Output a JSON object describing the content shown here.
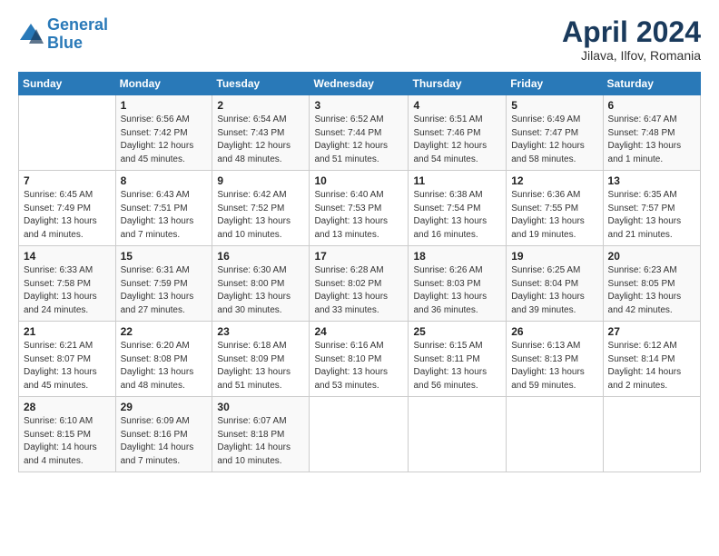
{
  "header": {
    "logo_line1": "General",
    "logo_line2": "Blue",
    "title": "April 2024",
    "subtitle": "Jilava, Ilfov, Romania"
  },
  "weekdays": [
    "Sunday",
    "Monday",
    "Tuesday",
    "Wednesday",
    "Thursday",
    "Friday",
    "Saturday"
  ],
  "weeks": [
    [
      {
        "day": "",
        "info": ""
      },
      {
        "day": "1",
        "info": "Sunrise: 6:56 AM\nSunset: 7:42 PM\nDaylight: 12 hours\nand 45 minutes."
      },
      {
        "day": "2",
        "info": "Sunrise: 6:54 AM\nSunset: 7:43 PM\nDaylight: 12 hours\nand 48 minutes."
      },
      {
        "day": "3",
        "info": "Sunrise: 6:52 AM\nSunset: 7:44 PM\nDaylight: 12 hours\nand 51 minutes."
      },
      {
        "day": "4",
        "info": "Sunrise: 6:51 AM\nSunset: 7:46 PM\nDaylight: 12 hours\nand 54 minutes."
      },
      {
        "day": "5",
        "info": "Sunrise: 6:49 AM\nSunset: 7:47 PM\nDaylight: 12 hours\nand 58 minutes."
      },
      {
        "day": "6",
        "info": "Sunrise: 6:47 AM\nSunset: 7:48 PM\nDaylight: 13 hours\nand 1 minute."
      }
    ],
    [
      {
        "day": "7",
        "info": "Sunrise: 6:45 AM\nSunset: 7:49 PM\nDaylight: 13 hours\nand 4 minutes."
      },
      {
        "day": "8",
        "info": "Sunrise: 6:43 AM\nSunset: 7:51 PM\nDaylight: 13 hours\nand 7 minutes."
      },
      {
        "day": "9",
        "info": "Sunrise: 6:42 AM\nSunset: 7:52 PM\nDaylight: 13 hours\nand 10 minutes."
      },
      {
        "day": "10",
        "info": "Sunrise: 6:40 AM\nSunset: 7:53 PM\nDaylight: 13 hours\nand 13 minutes."
      },
      {
        "day": "11",
        "info": "Sunrise: 6:38 AM\nSunset: 7:54 PM\nDaylight: 13 hours\nand 16 minutes."
      },
      {
        "day": "12",
        "info": "Sunrise: 6:36 AM\nSunset: 7:55 PM\nDaylight: 13 hours\nand 19 minutes."
      },
      {
        "day": "13",
        "info": "Sunrise: 6:35 AM\nSunset: 7:57 PM\nDaylight: 13 hours\nand 21 minutes."
      }
    ],
    [
      {
        "day": "14",
        "info": "Sunrise: 6:33 AM\nSunset: 7:58 PM\nDaylight: 13 hours\nand 24 minutes."
      },
      {
        "day": "15",
        "info": "Sunrise: 6:31 AM\nSunset: 7:59 PM\nDaylight: 13 hours\nand 27 minutes."
      },
      {
        "day": "16",
        "info": "Sunrise: 6:30 AM\nSunset: 8:00 PM\nDaylight: 13 hours\nand 30 minutes."
      },
      {
        "day": "17",
        "info": "Sunrise: 6:28 AM\nSunset: 8:02 PM\nDaylight: 13 hours\nand 33 minutes."
      },
      {
        "day": "18",
        "info": "Sunrise: 6:26 AM\nSunset: 8:03 PM\nDaylight: 13 hours\nand 36 minutes."
      },
      {
        "day": "19",
        "info": "Sunrise: 6:25 AM\nSunset: 8:04 PM\nDaylight: 13 hours\nand 39 minutes."
      },
      {
        "day": "20",
        "info": "Sunrise: 6:23 AM\nSunset: 8:05 PM\nDaylight: 13 hours\nand 42 minutes."
      }
    ],
    [
      {
        "day": "21",
        "info": "Sunrise: 6:21 AM\nSunset: 8:07 PM\nDaylight: 13 hours\nand 45 minutes."
      },
      {
        "day": "22",
        "info": "Sunrise: 6:20 AM\nSunset: 8:08 PM\nDaylight: 13 hours\nand 48 minutes."
      },
      {
        "day": "23",
        "info": "Sunrise: 6:18 AM\nSunset: 8:09 PM\nDaylight: 13 hours\nand 51 minutes."
      },
      {
        "day": "24",
        "info": "Sunrise: 6:16 AM\nSunset: 8:10 PM\nDaylight: 13 hours\nand 53 minutes."
      },
      {
        "day": "25",
        "info": "Sunrise: 6:15 AM\nSunset: 8:11 PM\nDaylight: 13 hours\nand 56 minutes."
      },
      {
        "day": "26",
        "info": "Sunrise: 6:13 AM\nSunset: 8:13 PM\nDaylight: 13 hours\nand 59 minutes."
      },
      {
        "day": "27",
        "info": "Sunrise: 6:12 AM\nSunset: 8:14 PM\nDaylight: 14 hours\nand 2 minutes."
      }
    ],
    [
      {
        "day": "28",
        "info": "Sunrise: 6:10 AM\nSunset: 8:15 PM\nDaylight: 14 hours\nand 4 minutes."
      },
      {
        "day": "29",
        "info": "Sunrise: 6:09 AM\nSunset: 8:16 PM\nDaylight: 14 hours\nand 7 minutes."
      },
      {
        "day": "30",
        "info": "Sunrise: 6:07 AM\nSunset: 8:18 PM\nDaylight: 14 hours\nand 10 minutes."
      },
      {
        "day": "",
        "info": ""
      },
      {
        "day": "",
        "info": ""
      },
      {
        "day": "",
        "info": ""
      },
      {
        "day": "",
        "info": ""
      }
    ]
  ]
}
